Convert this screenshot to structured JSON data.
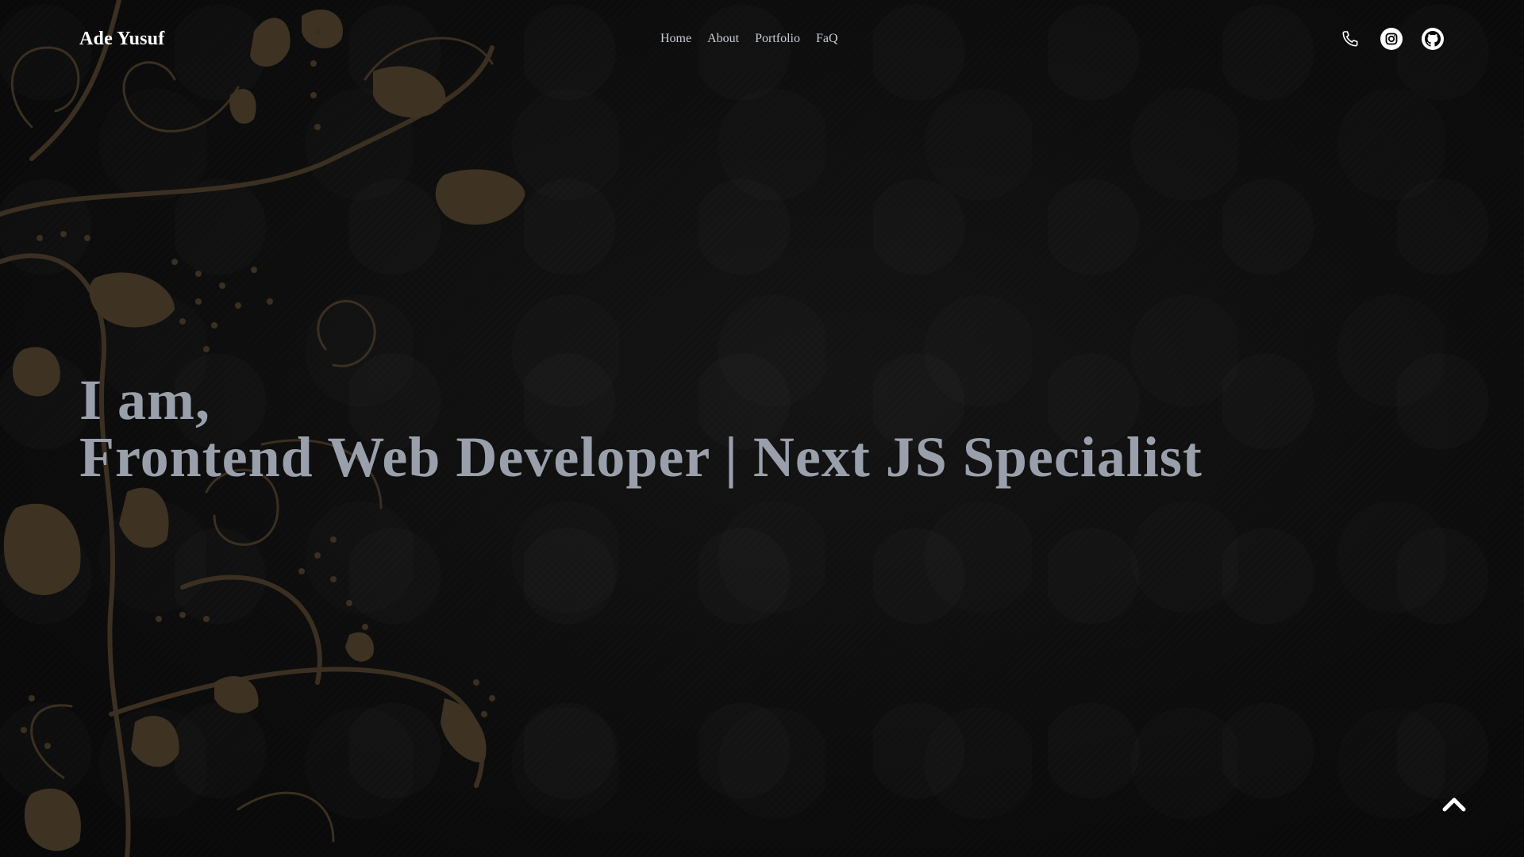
{
  "header": {
    "brand": "Ade Yusuf",
    "nav": [
      {
        "label": "Home"
      },
      {
        "label": "About"
      },
      {
        "label": "Portfolio"
      },
      {
        "label": "FaQ"
      }
    ],
    "socials": [
      {
        "icon": "phone-icon"
      },
      {
        "icon": "instagram-icon"
      },
      {
        "icon": "github-icon"
      }
    ]
  },
  "hero": {
    "line1": "I am,",
    "line2": "Frontend Web Developer | Next JS Specialist"
  },
  "scroll_top": {
    "icon": "chevron-up-icon"
  },
  "colors": {
    "background": "#0b0b0b",
    "floral": "#3e3222",
    "hero_text": "#9aa0ab",
    "brand_text": "#ffffff",
    "nav_text": "#c9cdd4"
  }
}
